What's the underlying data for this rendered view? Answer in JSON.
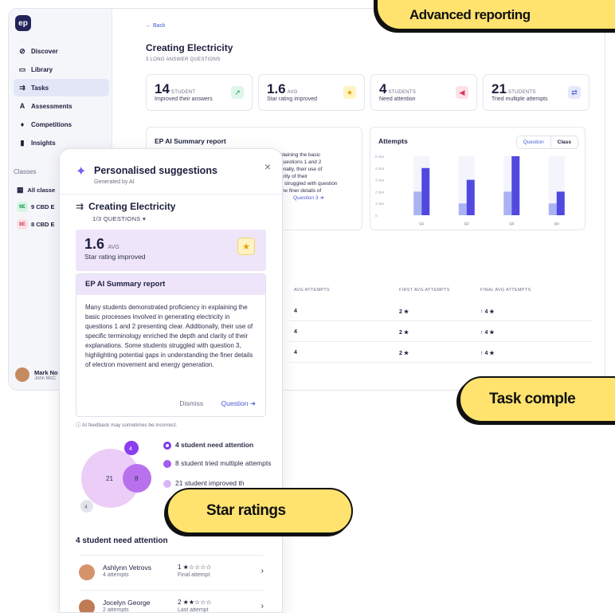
{
  "sidebar": {
    "logo": "ep",
    "nav": [
      {
        "label": "Discover",
        "icon": "⊘"
      },
      {
        "label": "Library",
        "icon": "▭"
      },
      {
        "label": "Tasks",
        "icon": "⇉"
      },
      {
        "label": "Assessments",
        "icon": "A"
      },
      {
        "label": "Competitions",
        "icon": "♦"
      },
      {
        "label": "Insights",
        "icon": "▮"
      }
    ],
    "classes_label": "Classes",
    "all_classes": "All classe",
    "classes": [
      {
        "badge": "9E",
        "name": "9 CBD E",
        "color": "#d7f6e4",
        "text": "#1a8f4f"
      },
      {
        "badge": "8E",
        "name": "8 CBD E",
        "color": "#fde1e6",
        "text": "#d03b5c"
      }
    ],
    "user": {
      "name": "Mark No",
      "sub": "John McC"
    }
  },
  "main": {
    "back": "← Back",
    "title": "Creating Electricity",
    "subtitle": "3 LONG ANSWER QUESTIONS",
    "stats": [
      {
        "num": "14",
        "unit": "STUDENT",
        "label": "Improved their answers",
        "icon": "↗",
        "bg": "#dff6ea",
        "fg": "#1f9d59"
      },
      {
        "num": "1.6",
        "unit": "AVG",
        "label": "Star rating improved",
        "icon": "★",
        "bg": "#fff3c4",
        "fg": "#e5a100"
      },
      {
        "num": "4",
        "unit": "STUDENTS",
        "label": "Need attention",
        "icon": "◀",
        "bg": "#fde1e6",
        "fg": "#d03b5c"
      },
      {
        "num": "21",
        "unit": "STUDENTS",
        "label": "Tried multiple attempts",
        "icon": "⇄",
        "bg": "#e6e8fb",
        "fg": "#4a5bd6"
      }
    ],
    "summary_title": "EP AI Summary report",
    "summary_lines": [
      "plaining the basic",
      "questions 1 and 2",
      "onally, their use of",
      "arity of their",
      "s struggled with question",
      "the finer details of"
    ],
    "summary_link": "Question 3",
    "attempts_title": "Attempts",
    "seg": [
      "Question",
      "Class"
    ],
    "table_headers": [
      "AVG ATTEMPTS",
      "FIRST AVG ATTEMPTS",
      "FINAL AVG ATTEMPTS"
    ],
    "table_rows": [
      {
        "avg": "4",
        "first": "2 ★",
        "final": "↑ 4 ★"
      },
      {
        "avg": "4",
        "first": "2 ★",
        "final": "↑ 4 ★"
      },
      {
        "avg": "4",
        "first": "2 ★",
        "final": "↑ 4 ★"
      }
    ]
  },
  "chart_data": {
    "type": "bar",
    "categories": [
      "Q1",
      "Q2",
      "Q3",
      "Q4"
    ],
    "y_ticks": [
      "5 star",
      "4 star",
      "3 star",
      "2 star",
      "1 star",
      "0"
    ],
    "ylim": [
      0,
      5
    ],
    "series": [
      {
        "values": [
          2,
          1,
          2,
          1
        ],
        "color": "#a9b3f4"
      },
      {
        "values": [
          4,
          3,
          5,
          2
        ],
        "color": "#5148e0"
      }
    ],
    "grid": false,
    "legend": "none"
  },
  "card": {
    "title": "Personalised suggestions",
    "sub": "Generated by AI",
    "task": "Creating Electricity",
    "questions": "1/3 QUESTIONS ▾",
    "hero": {
      "num": "1.6",
      "unit": "AVG",
      "label": "Star rating improved"
    },
    "summary_title": "EP AI Summary report",
    "summary_body": "Many students demonstrated proficiency in explaining the basic processes involved in generating electricity in questions 1 and 2 presenting clear. Additionally, their use of specific terminology enriched the depth and clarity of their explanations. Some students struggled with question 3, highlighting potential gaps in understanding the finer details of electron movement and energy generation.",
    "dismiss": "Dismiss",
    "question": "Question ➜",
    "disclaimer": "ⓘ AI feedback may sometimes be incorrect.",
    "bubbles": {
      "big": "21",
      "mid": "8",
      "small_top": "4",
      "small_bottom": "4"
    },
    "legend": [
      {
        "text": "4 student need attention",
        "color": "#7c3be8",
        "bold": true
      },
      {
        "text": "8 student tried multiple attempts",
        "color": "#a25cf0",
        "bold": false
      },
      {
        "text": "21 student improved th",
        "color": "#d8b6f7",
        "bold": false
      }
    ],
    "need_title": "4 student need attention",
    "students": [
      {
        "name": "Ashlynn Vetrovs",
        "attempts": "4 attempts",
        "rating": "1 ★☆☆☆☆",
        "final": "Final attempt"
      },
      {
        "name": "Jocelyn George",
        "attempts": "2 attempts",
        "rating": "2 ★★☆☆☆",
        "final": "Last attempt"
      }
    ]
  },
  "pills": {
    "advanced": "Advanced reporting",
    "task": "Task comple",
    "star": "Star ratings"
  }
}
